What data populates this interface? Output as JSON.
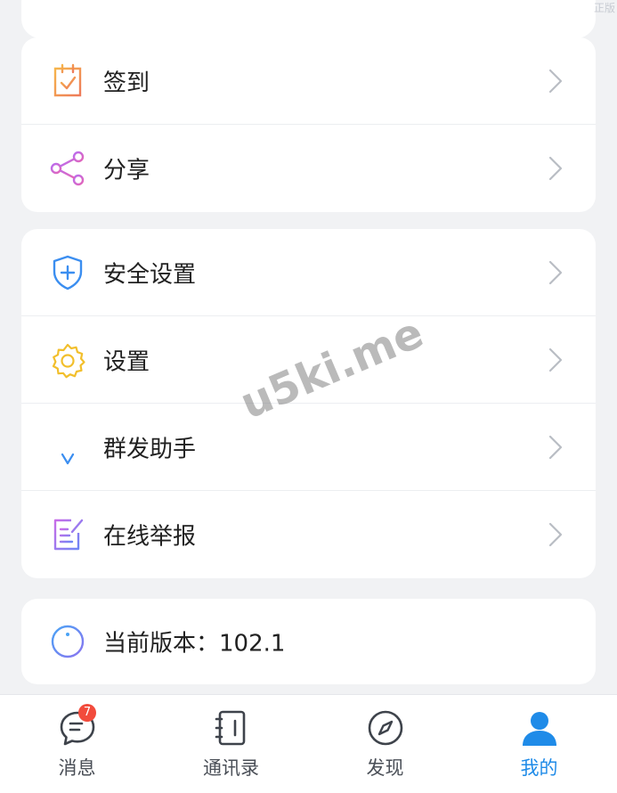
{
  "corner_mark": "正版",
  "menu_group_1": [
    {
      "label": "签到",
      "icon": "checkin-calendar-icon",
      "color": "#f0a24b"
    },
    {
      "label": "分享",
      "icon": "share-icon",
      "color": "#b25ee4"
    }
  ],
  "menu_group_2": [
    {
      "label": "安全设置",
      "icon": "security-shield-icon",
      "color": "#3b8ef0"
    },
    {
      "label": "设置",
      "icon": "gear-icon",
      "color": "#f2bf2c"
    },
    {
      "label": "群发助手",
      "icon": "broadcast-assistant-icon",
      "color": "#3b8ef0"
    },
    {
      "label": "在线举报",
      "icon": "report-edit-icon",
      "color": "#8a6cf2"
    }
  ],
  "version": {
    "label": "当前版本：102.1",
    "icon": "info-icon"
  },
  "watermark": "u5ki.me",
  "tabbar": {
    "active_color": "#1f8be8",
    "tabs": [
      {
        "label": "消息",
        "icon": "chat-bubble-icon",
        "badge": "7",
        "active": false
      },
      {
        "label": "通讯录",
        "icon": "contacts-book-icon",
        "active": false
      },
      {
        "label": "发现",
        "icon": "compass-icon",
        "active": false
      },
      {
        "label": "我的",
        "icon": "person-icon",
        "active": true
      }
    ]
  }
}
